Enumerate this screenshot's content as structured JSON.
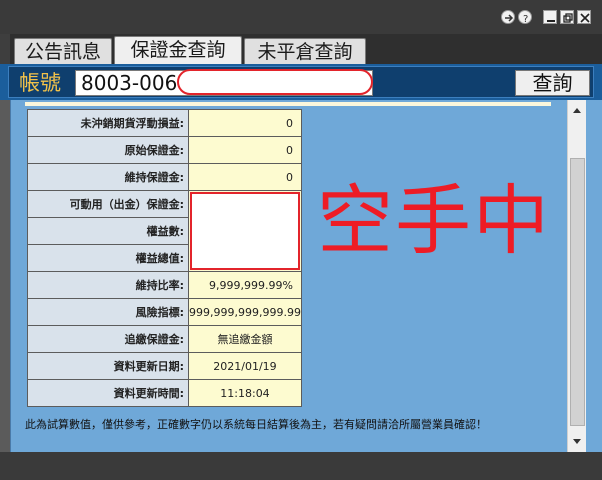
{
  "window": {
    "icons": [
      "back-arrow-icon",
      "help-icon",
      "minimize-icon",
      "restore-icon",
      "close-icon"
    ]
  },
  "tabs": [
    {
      "label": "公告訊息",
      "active": false
    },
    {
      "label": "保證金查詢",
      "active": true
    },
    {
      "label": "未平倉查詢",
      "active": false
    }
  ],
  "account": {
    "label": "帳號",
    "value": "8003-0066",
    "query_label": "查詢"
  },
  "rows": [
    {
      "label": "未沖銷期貨浮動損益:",
      "value": "0"
    },
    {
      "label": "原始保證金:",
      "value": "0"
    },
    {
      "label": "維持保證金:",
      "value": "0"
    },
    {
      "label": "可動用（出金）保證金:",
      "value": ""
    },
    {
      "label": "權益數:",
      "value": ""
    },
    {
      "label": "權益總值:",
      "value": ""
    },
    {
      "label": "維持比率:",
      "value": "9,999,999.99%"
    },
    {
      "label": "風險指標:",
      "value": "999,999,999,999.99"
    },
    {
      "label": "追繳保證金:",
      "value": "無追繳金額"
    },
    {
      "label": "資料更新日期:",
      "value": "2021/01/19"
    },
    {
      "label": "資料更新時間:",
      "value": "11:18:04"
    }
  ],
  "status_big": "空手中",
  "footnote": "此為試算數值，僅供參考，正確數字仍以系統每日結算後為主，若有疑問請洽所屬營業員確認！",
  "colors": {
    "panel": "#6fa8d8",
    "account_bar": "#0f3f6e",
    "label_gold": "#f2c24a",
    "status_red": "#ee1c25"
  }
}
